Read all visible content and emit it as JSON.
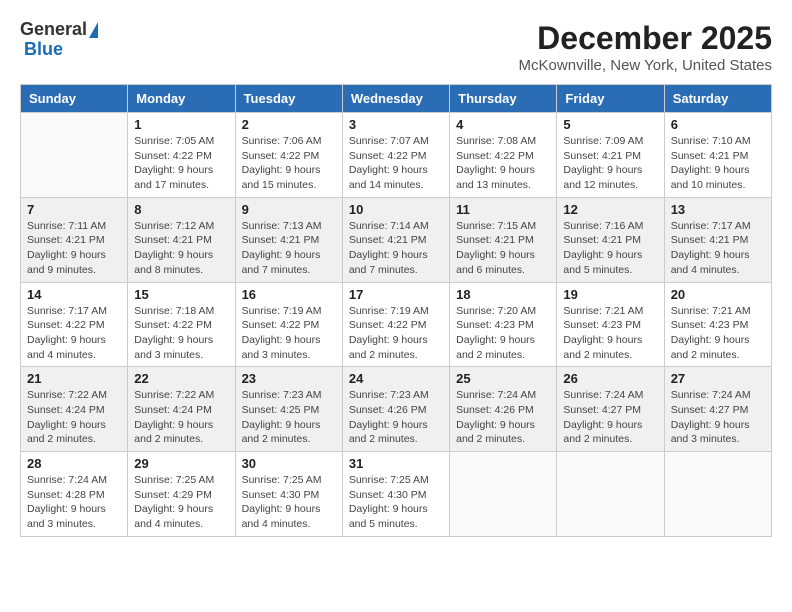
{
  "header": {
    "logo_general": "General",
    "logo_blue": "Blue",
    "month": "December 2025",
    "location": "McKownville, New York, United States"
  },
  "days_of_week": [
    "Sunday",
    "Monday",
    "Tuesday",
    "Wednesday",
    "Thursday",
    "Friday",
    "Saturday"
  ],
  "weeks": [
    [
      {
        "day": "",
        "empty": true
      },
      {
        "day": "1",
        "sunrise": "Sunrise: 7:05 AM",
        "sunset": "Sunset: 4:22 PM",
        "daylight": "Daylight: 9 hours and 17 minutes."
      },
      {
        "day": "2",
        "sunrise": "Sunrise: 7:06 AM",
        "sunset": "Sunset: 4:22 PM",
        "daylight": "Daylight: 9 hours and 15 minutes."
      },
      {
        "day": "3",
        "sunrise": "Sunrise: 7:07 AM",
        "sunset": "Sunset: 4:22 PM",
        "daylight": "Daylight: 9 hours and 14 minutes."
      },
      {
        "day": "4",
        "sunrise": "Sunrise: 7:08 AM",
        "sunset": "Sunset: 4:22 PM",
        "daylight": "Daylight: 9 hours and 13 minutes."
      },
      {
        "day": "5",
        "sunrise": "Sunrise: 7:09 AM",
        "sunset": "Sunset: 4:21 PM",
        "daylight": "Daylight: 9 hours and 12 minutes."
      },
      {
        "day": "6",
        "sunrise": "Sunrise: 7:10 AM",
        "sunset": "Sunset: 4:21 PM",
        "daylight": "Daylight: 9 hours and 10 minutes."
      }
    ],
    [
      {
        "day": "7",
        "sunrise": "Sunrise: 7:11 AM",
        "sunset": "Sunset: 4:21 PM",
        "daylight": "Daylight: 9 hours and 9 minutes."
      },
      {
        "day": "8",
        "sunrise": "Sunrise: 7:12 AM",
        "sunset": "Sunset: 4:21 PM",
        "daylight": "Daylight: 9 hours and 8 minutes."
      },
      {
        "day": "9",
        "sunrise": "Sunrise: 7:13 AM",
        "sunset": "Sunset: 4:21 PM",
        "daylight": "Daylight: 9 hours and 7 minutes."
      },
      {
        "day": "10",
        "sunrise": "Sunrise: 7:14 AM",
        "sunset": "Sunset: 4:21 PM",
        "daylight": "Daylight: 9 hours and 7 minutes."
      },
      {
        "day": "11",
        "sunrise": "Sunrise: 7:15 AM",
        "sunset": "Sunset: 4:21 PM",
        "daylight": "Daylight: 9 hours and 6 minutes."
      },
      {
        "day": "12",
        "sunrise": "Sunrise: 7:16 AM",
        "sunset": "Sunset: 4:21 PM",
        "daylight": "Daylight: 9 hours and 5 minutes."
      },
      {
        "day": "13",
        "sunrise": "Sunrise: 7:17 AM",
        "sunset": "Sunset: 4:21 PM",
        "daylight": "Daylight: 9 hours and 4 minutes."
      }
    ],
    [
      {
        "day": "14",
        "sunrise": "Sunrise: 7:17 AM",
        "sunset": "Sunset: 4:22 PM",
        "daylight": "Daylight: 9 hours and 4 minutes."
      },
      {
        "day": "15",
        "sunrise": "Sunrise: 7:18 AM",
        "sunset": "Sunset: 4:22 PM",
        "daylight": "Daylight: 9 hours and 3 minutes."
      },
      {
        "day": "16",
        "sunrise": "Sunrise: 7:19 AM",
        "sunset": "Sunset: 4:22 PM",
        "daylight": "Daylight: 9 hours and 3 minutes."
      },
      {
        "day": "17",
        "sunrise": "Sunrise: 7:19 AM",
        "sunset": "Sunset: 4:22 PM",
        "daylight": "Daylight: 9 hours and 2 minutes."
      },
      {
        "day": "18",
        "sunrise": "Sunrise: 7:20 AM",
        "sunset": "Sunset: 4:23 PM",
        "daylight": "Daylight: 9 hours and 2 minutes."
      },
      {
        "day": "19",
        "sunrise": "Sunrise: 7:21 AM",
        "sunset": "Sunset: 4:23 PM",
        "daylight": "Daylight: 9 hours and 2 minutes."
      },
      {
        "day": "20",
        "sunrise": "Sunrise: 7:21 AM",
        "sunset": "Sunset: 4:23 PM",
        "daylight": "Daylight: 9 hours and 2 minutes."
      }
    ],
    [
      {
        "day": "21",
        "sunrise": "Sunrise: 7:22 AM",
        "sunset": "Sunset: 4:24 PM",
        "daylight": "Daylight: 9 hours and 2 minutes."
      },
      {
        "day": "22",
        "sunrise": "Sunrise: 7:22 AM",
        "sunset": "Sunset: 4:24 PM",
        "daylight": "Daylight: 9 hours and 2 minutes."
      },
      {
        "day": "23",
        "sunrise": "Sunrise: 7:23 AM",
        "sunset": "Sunset: 4:25 PM",
        "daylight": "Daylight: 9 hours and 2 minutes."
      },
      {
        "day": "24",
        "sunrise": "Sunrise: 7:23 AM",
        "sunset": "Sunset: 4:26 PM",
        "daylight": "Daylight: 9 hours and 2 minutes."
      },
      {
        "day": "25",
        "sunrise": "Sunrise: 7:24 AM",
        "sunset": "Sunset: 4:26 PM",
        "daylight": "Daylight: 9 hours and 2 minutes."
      },
      {
        "day": "26",
        "sunrise": "Sunrise: 7:24 AM",
        "sunset": "Sunset: 4:27 PM",
        "daylight": "Daylight: 9 hours and 2 minutes."
      },
      {
        "day": "27",
        "sunrise": "Sunrise: 7:24 AM",
        "sunset": "Sunset: 4:27 PM",
        "daylight": "Daylight: 9 hours and 3 minutes."
      }
    ],
    [
      {
        "day": "28",
        "sunrise": "Sunrise: 7:24 AM",
        "sunset": "Sunset: 4:28 PM",
        "daylight": "Daylight: 9 hours and 3 minutes."
      },
      {
        "day": "29",
        "sunrise": "Sunrise: 7:25 AM",
        "sunset": "Sunset: 4:29 PM",
        "daylight": "Daylight: 9 hours and 4 minutes."
      },
      {
        "day": "30",
        "sunrise": "Sunrise: 7:25 AM",
        "sunset": "Sunset: 4:30 PM",
        "daylight": "Daylight: 9 hours and 4 minutes."
      },
      {
        "day": "31",
        "sunrise": "Sunrise: 7:25 AM",
        "sunset": "Sunset: 4:30 PM",
        "daylight": "Daylight: 9 hours and 5 minutes."
      },
      {
        "day": "",
        "empty": true
      },
      {
        "day": "",
        "empty": true
      },
      {
        "day": "",
        "empty": true
      }
    ]
  ]
}
